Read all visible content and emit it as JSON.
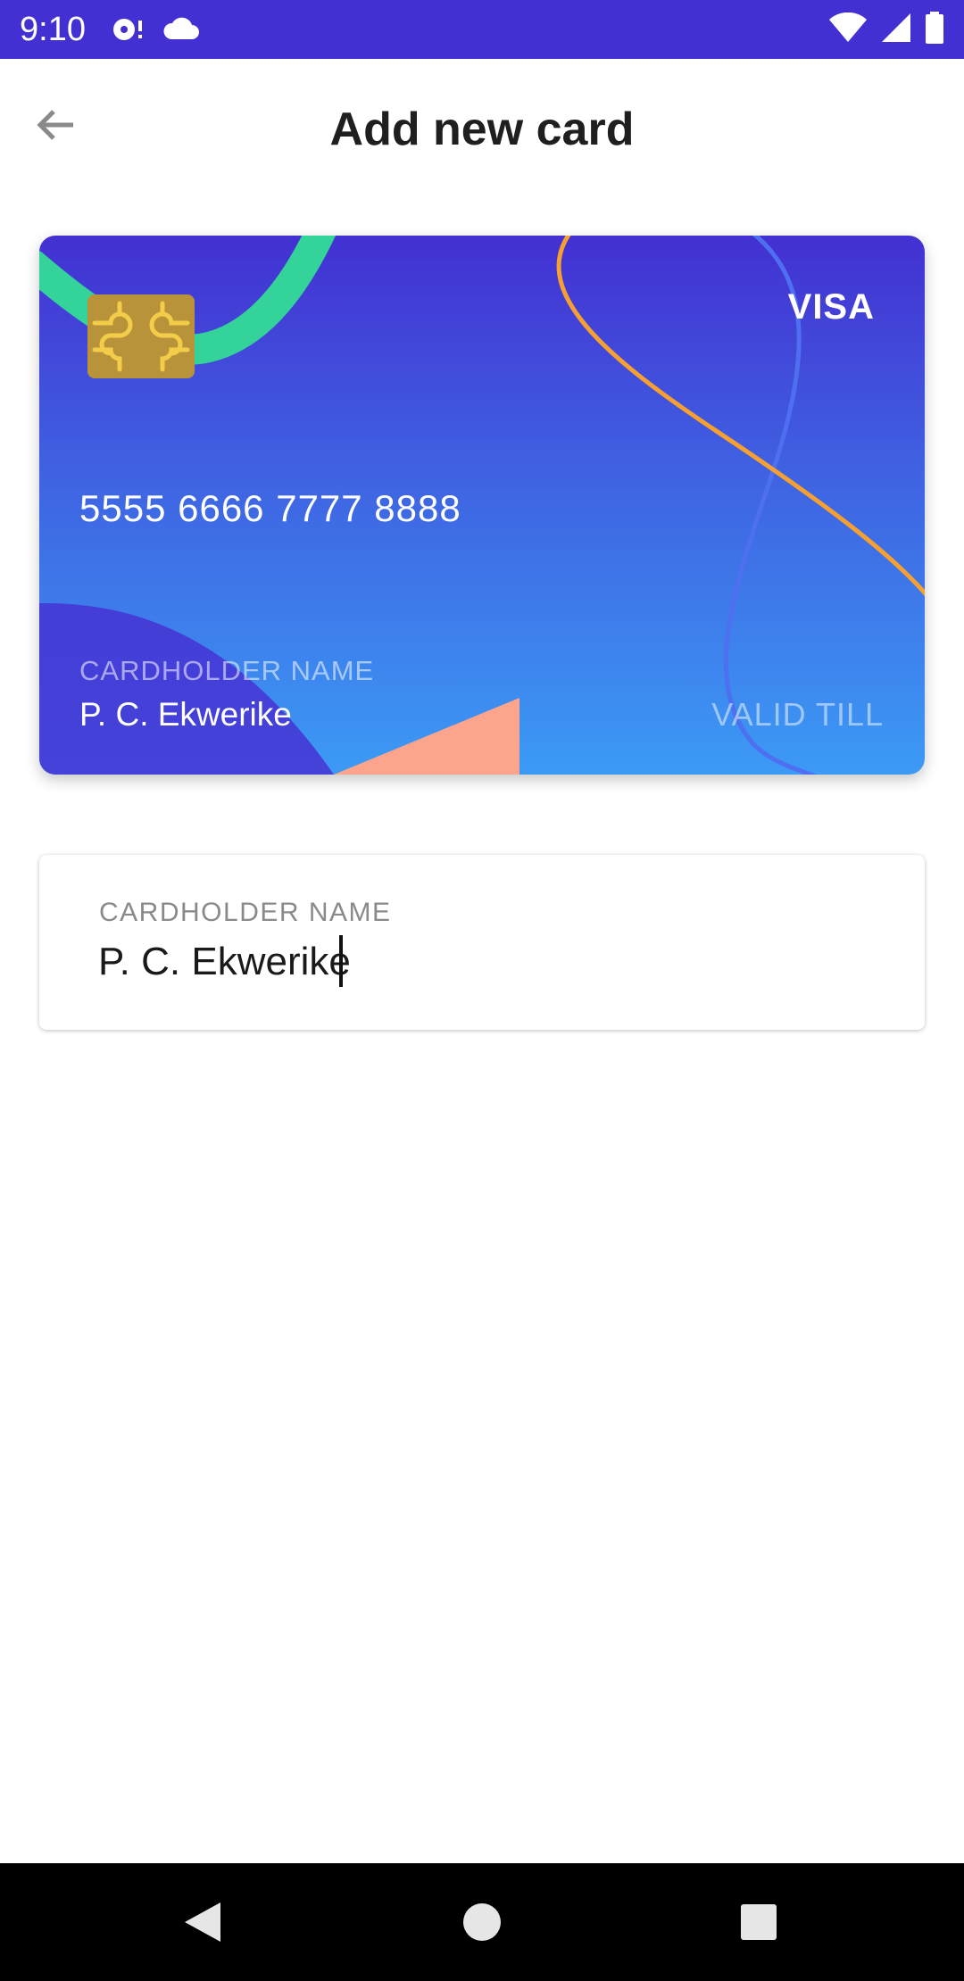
{
  "status_bar": {
    "time": "9:10",
    "left_icons": [
      "media-cast-icon",
      "cloud-icon"
    ],
    "right_icons": [
      "wifi-icon",
      "cell-signal-icon",
      "battery-icon"
    ],
    "color": "#4330d2"
  },
  "app_bar": {
    "title": "Add new card",
    "back_icon": "arrow-left-icon"
  },
  "card": {
    "brand": "VISA",
    "number": "5555 6666 7777 8888",
    "holder_caption": "CARDHOLDER NAME",
    "holder_name": "P. C. Ekwerike",
    "valid_till_caption": "VALID TILL",
    "colors": {
      "gradient_top": "#4330d2",
      "gradient_bottom": "#3c9af5",
      "accent_green": "#34d399",
      "accent_orange": "#f5a031",
      "accent_peach": "#fda58c",
      "chip": "#b8933a"
    }
  },
  "form": {
    "cardholder_label": "CARDHOLDER NAME",
    "cardholder_value": "P. C. Ekwerike"
  },
  "nav_bar": {
    "buttons": [
      "back-triangle-icon",
      "home-circle-icon",
      "recents-square-icon"
    ]
  }
}
